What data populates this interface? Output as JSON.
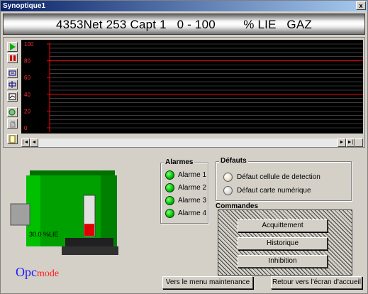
{
  "window": {
    "title": "Synoptique1",
    "close_label": "x"
  },
  "banner": {
    "text": "4353Net 253 Capt 1   0 - 100        % LIE   GAZ"
  },
  "chart_data": {
    "type": "line",
    "title": "",
    "xlabel": "",
    "ylabel": "",
    "ylim": [
      0,
      100
    ],
    "yticks": [
      "100",
      "80",
      "60",
      "40",
      "20",
      "0"
    ],
    "series": [],
    "grid": true,
    "threshold_lines": [
      40,
      80
    ],
    "colors": {
      "background": "#000000",
      "grid": "#606060",
      "threshold": "#ff0000",
      "axis_text": "#ff3030"
    }
  },
  "toolbar": {
    "play_icon": "play-icon",
    "pause_icon": "pause-icon",
    "buttons": [
      "zoom-in-icon",
      "zoom-out-icon",
      "fit-icon",
      "search-icon",
      "hand-icon",
      "legend-icon"
    ]
  },
  "scroll": {
    "left_label": "◄",
    "first_label": "|◄",
    "right_label": "►",
    "last_label": "►|"
  },
  "sensor": {
    "reading": "30.0 %LIE",
    "level": 0.3,
    "colors": {
      "body": "#00a000",
      "level": "#e00000"
    }
  },
  "alarms": {
    "title": "Alarmes",
    "items": [
      "Alarme 1",
      "Alarme 2",
      "Alarme 3",
      "Alarme 4"
    ]
  },
  "faults": {
    "title": "Défauts",
    "items": [
      {
        "label": "Défaut cellule de detection",
        "color": "#e8e0c8"
      },
      {
        "label": "Défaut carte numérique",
        "color": "#d8d8d8"
      }
    ]
  },
  "commands": {
    "title": "Commandes",
    "buttons": [
      "Acquittement",
      "Historique",
      "Inhibition"
    ]
  },
  "nav": {
    "maintenance": "Vers le menu maintenance",
    "home": "Retour vers l'écran d'accueil"
  },
  "logo": {
    "part1": "Opc",
    "part2": "mode"
  }
}
